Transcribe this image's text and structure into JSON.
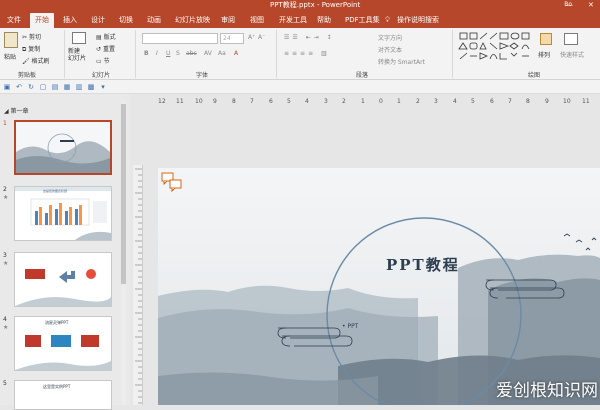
{
  "window": {
    "title": "PPT教程.pptx - PowerPoint",
    "user": "Bo",
    "minimize_glyph": "—",
    "close_glyph": "✕"
  },
  "ribbon_tabs": [
    "文件",
    "开始",
    "插入",
    "设计",
    "切换",
    "动画",
    "幻灯片放映",
    "审阅",
    "视图",
    "开发工具",
    "帮助",
    "PDF工具集",
    "操作说明搜索"
  ],
  "active_tab": "开始",
  "ribbon": {
    "clipboard": {
      "paste": "粘贴",
      "cut": "剪切",
      "copy": "复制",
      "format_painter": "格式刷",
      "label": "剪贴板"
    },
    "slides": {
      "new_slide": "新建\n幻灯片",
      "reuse": "重用\n幻灯片",
      "layout": "版式",
      "reset": "重置",
      "section": "节",
      "label": "幻灯片"
    },
    "font": {
      "label": "字体",
      "size": "24"
    },
    "paragraph": {
      "text_direction": "文字方向",
      "align_text": "对齐文本",
      "smartart": "转换为 SmartArt",
      "label": "段落"
    },
    "drawing": {
      "arrange": "排列",
      "quick_styles": "快速样式",
      "label": "绘图"
    }
  },
  "section_name": "第一章",
  "slides": [
    {
      "num": "1",
      "active": true
    },
    {
      "num": "2",
      "active": false,
      "title": "这是您的图表标题"
    },
    {
      "num": "3",
      "active": false
    },
    {
      "num": "4",
      "active": false,
      "title": "流星灵弹PPT"
    },
    {
      "num": "5",
      "active": false,
      "title": "这里是实例PPT"
    }
  ],
  "ruler_ticks": [
    "12",
    "11",
    "10",
    "9",
    "8",
    "7",
    "6",
    "5",
    "4",
    "3",
    "2",
    "1",
    "0",
    "1",
    "2",
    "3",
    "4",
    "5",
    "6",
    "7",
    "8",
    "9",
    "10",
    "11"
  ],
  "main_slide": {
    "title": "PPT教程",
    "subtitle": "• PPT"
  },
  "watermark": "爱创根知识网",
  "colors": {
    "accent": "#b7472a",
    "circle": "#6b8aa6",
    "ink": "#2d3e50"
  }
}
